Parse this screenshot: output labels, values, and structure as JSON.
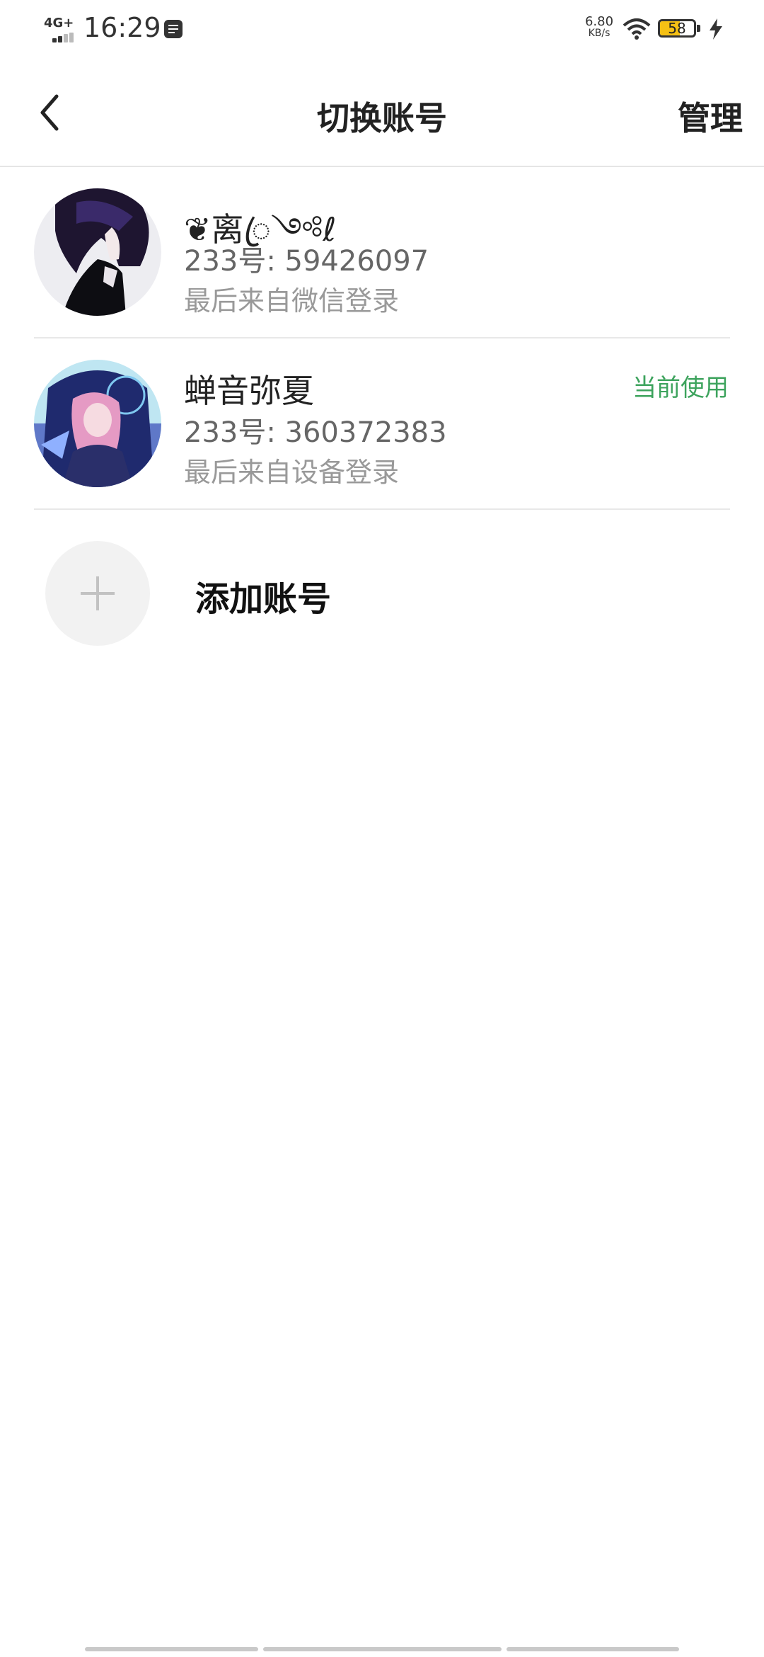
{
  "status_bar": {
    "network_type": "4G+",
    "time": "16:29",
    "net_speed_value": "6.80",
    "net_speed_unit": "KB/s",
    "battery_level": "58",
    "battery_color": "#f5c014"
  },
  "header": {
    "title": "切换账号",
    "manage_label": "管理"
  },
  "accounts": [
    {
      "name": "❦离ꦿ༺ℓ",
      "id_text": "233号: 59426097",
      "login_text": "最后来自微信登录",
      "current": false,
      "avatar_icon": "dark-hair-character-avatar"
    },
    {
      "name": "蝉音弥夏",
      "id_text": "233号: 360372383",
      "login_text": "最后来自设备登录",
      "current": true,
      "current_label": "当前使用",
      "avatar_icon": "pink-hair-character-avatar"
    }
  ],
  "add_account": {
    "label": "添加账号",
    "icon": "plus-icon"
  },
  "colors": {
    "accent_green": "#3da35d",
    "divider": "#e8e8e8"
  }
}
